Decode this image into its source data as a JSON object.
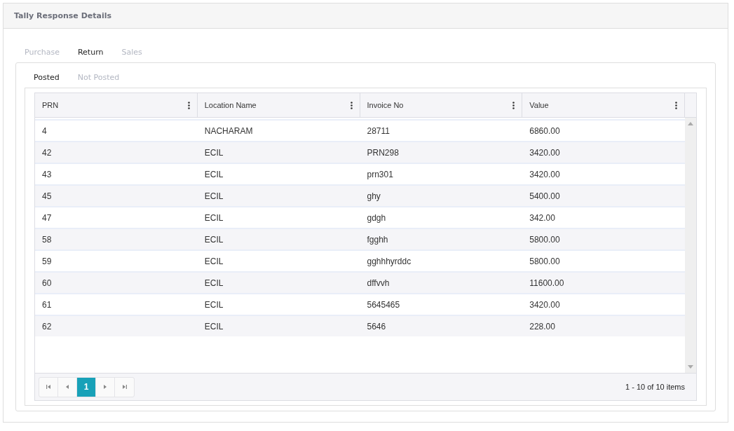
{
  "panel": {
    "title": "Tally Response Details"
  },
  "tabs": [
    {
      "label": "Purchase",
      "selected": false
    },
    {
      "label": "Return",
      "selected": true
    },
    {
      "label": "Sales",
      "selected": false
    }
  ],
  "subtabs": [
    {
      "label": "Posted",
      "selected": true
    },
    {
      "label": "Not Posted",
      "selected": false
    }
  ],
  "table": {
    "columns": [
      "PRN",
      "Location Name",
      "Invoice No",
      "Value"
    ],
    "rows": [
      [
        "4",
        "NACHARAM",
        "28711",
        "6860.00"
      ],
      [
        "42",
        "ECIL",
        "PRN298",
        "3420.00"
      ],
      [
        "43",
        "ECIL",
        "prn301",
        "3420.00"
      ],
      [
        "45",
        "ECIL",
        "ghy",
        "5400.00"
      ],
      [
        "47",
        "ECIL",
        "gdgh",
        "342.00"
      ],
      [
        "58",
        "ECIL",
        "fgghh",
        "5800.00"
      ],
      [
        "59",
        "ECIL",
        "gghhhyrddc",
        "5800.00"
      ],
      [
        "60",
        "ECIL",
        "dffvvh",
        "11600.00"
      ],
      [
        "61",
        "ECIL",
        "5645465",
        "3420.00"
      ],
      [
        "62",
        "ECIL",
        "5646",
        "228.00"
      ]
    ]
  },
  "pager": {
    "pages": [
      {
        "label": "1",
        "selected": true
      }
    ],
    "summary": "1 - 10 of 10 items"
  }
}
